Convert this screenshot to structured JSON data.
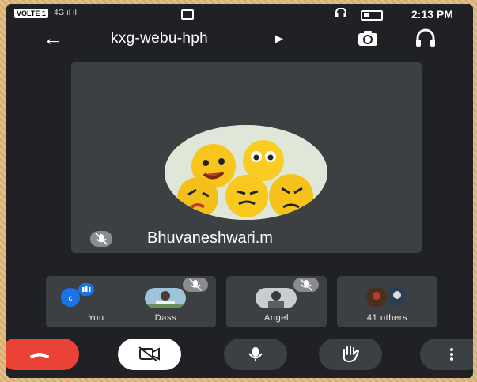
{
  "status_bar": {
    "carrier_badge": "VOLTE 1",
    "network": "4G",
    "clock": "2:13 PM"
  },
  "header": {
    "back_icon": "arrow-left-icon",
    "meeting_code": "kxg-webu-hph",
    "switch_camera_icon": "switch-camera-icon",
    "audio_icon": "headphones-icon"
  },
  "main_tile": {
    "participant_name": "Bhuvaneshwari.m",
    "mic_state": "muted"
  },
  "participants": [
    {
      "label": "You",
      "mic_state": "unmuted"
    },
    {
      "label": "Dass",
      "mic_state": "muted"
    },
    {
      "label": "Angel",
      "mic_state": "muted"
    },
    {
      "label": "41 others",
      "mic_state": ""
    }
  ],
  "controls": {
    "end_call_icon": "phone-hangup-icon",
    "camera_icon": "camera-off-icon",
    "mic_icon": "microphone-icon",
    "raise_hand_icon": "hand-icon",
    "more_icon": "more-vertical-icon"
  },
  "colors": {
    "background": "#202124",
    "tile": "#3c4043",
    "end_call": "#ea4335",
    "google_blue": "#1a73e8",
    "frame": "#d9b27a"
  }
}
